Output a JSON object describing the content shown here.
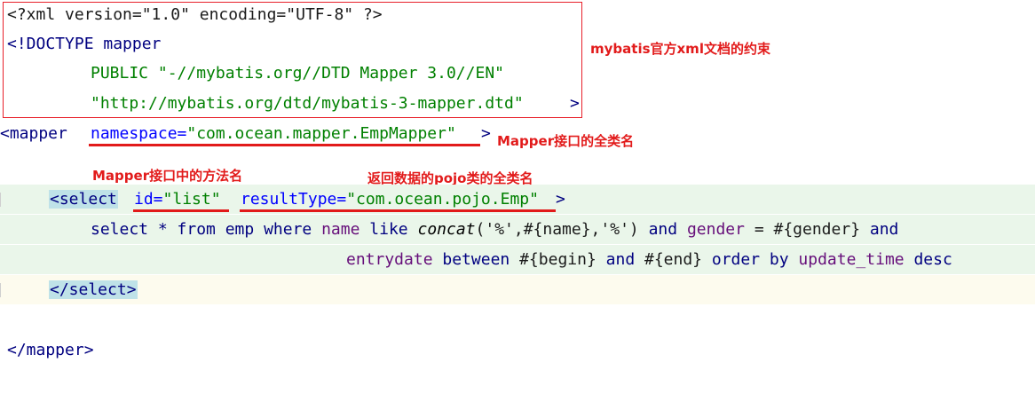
{
  "xml_declaration": "<?xml version=\"1.0\" encoding=\"UTF-8\" ?>",
  "doctype": {
    "open": "<!DOCTYPE mapper",
    "public": "PUBLIC \"-//mybatis.org//DTD Mapper 3.0//EN\"",
    "dtd_prefix": "\"http://mybatis.org/dtd/mybatis-3-mapper.dtd\"",
    "dtd_close": ">"
  },
  "mapper_open": {
    "tag": "<mapper",
    "namespace": "namespace=\"com.ocean.mapper.EmpMapper\"",
    "close": ">"
  },
  "select_open": {
    "open_angle": "<",
    "tag_name": "select",
    "id_attr": "id=",
    "id_value": "\"list\"",
    "rt_attr": "resultType=",
    "rt_value": "\"com.ocean.pojo.Emp\"",
    "close": ">"
  },
  "sql": {
    "line1": {
      "p1": "select * from emp where ",
      "p2": "name",
      "p3": " like ",
      "p4": "concat",
      "p5": "('%',#{name},'%') ",
      "p6": "and",
      "p7": " ",
      "p8": "gender",
      "p9": " = #{gender} ",
      "p10": "and"
    },
    "line2": {
      "p1": "entrydate",
      "p2": " between ",
      "p3": "#{begin} ",
      "p4": "and",
      "p5": " #{end} ",
      "p6": "order by ",
      "p7": "update_time",
      "p8": " desc"
    }
  },
  "select_close": "</select>",
  "mapper_close": "</mapper>",
  "annotations": {
    "header": "mybatis官方xml文档的约束",
    "namespace": "Mapper接口的全类名",
    "method": "Mapper接口中的方法名",
    "result_type": "返回数据的pojo类的全类名"
  },
  "colors": {
    "annotation_red": "#e21b1b",
    "tag_blue": "#000080",
    "attr_blue": "#0000ff",
    "value_green": "#008000",
    "line_highlight": "#eaf6ea"
  }
}
